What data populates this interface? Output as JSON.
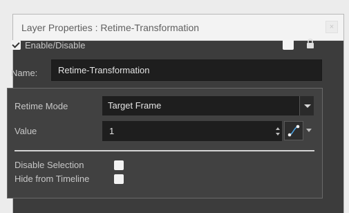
{
  "dialog": {
    "title": "Layer Properties : Retime-Transformation",
    "close_glyph": "×"
  },
  "enable": {
    "label": "Enable/Disable",
    "checked": true
  },
  "icons": {
    "color_swatch": "color-swatch-icon",
    "lock": "lock-icon",
    "spin": "up-down-arrows-icon",
    "function": "function-curve-icon"
  },
  "name": {
    "label": "Name:",
    "value": "Retime-Transformation"
  },
  "retime": {
    "mode_label": "Retime Mode",
    "mode_value": "Target Frame",
    "value_label": "Value",
    "value": "1"
  },
  "options": {
    "disable_selection_label": "Disable Selection",
    "disable_selection_checked": false,
    "hide_timeline_label": "Hide from Timeline",
    "hide_timeline_checked": false
  }
}
